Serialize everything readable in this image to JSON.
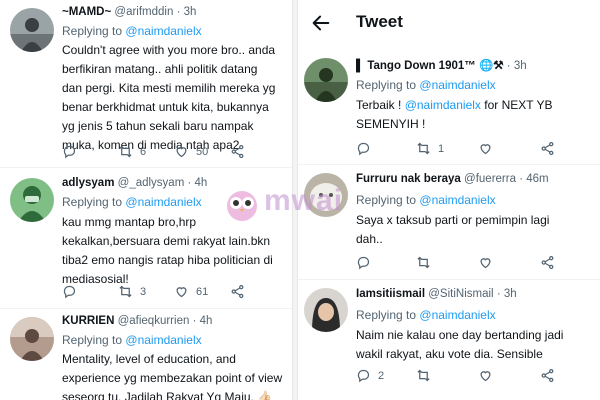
{
  "left_tweets": [
    {
      "name": "~MAMD~",
      "handle": "@arifmddin",
      "time": "3h",
      "replying_prefix": "Replying to",
      "replying_to": "@naimdanielx",
      "lines": [
        "Couldn't agree with you more bro.. anda",
        "berfikiran matang.. ahli politik datang",
        "dan pergi. Kita mesti memilih mereka yg",
        "benar berkhidmat untuk kita, bukannya",
        "yg jenis 5 tahun sekali baru nampak",
        "muka, komen di media ntah apa2"
      ],
      "replies": "",
      "retweets": "6",
      "likes": "50",
      "avatar_colors": [
        "#9aa3a6",
        "#3a3f44"
      ]
    },
    {
      "name": "adlysyam",
      "handle": "@_adlysyam",
      "time": "4h",
      "replying_prefix": "Replying to",
      "replying_to": "@naimdanielx",
      "lines": [
        "kau mmg mantap bro,hrp",
        "kekalkan,bersuara demi rakyat lain.bkn",
        "tiba2 emo nangis ratap hiba politician di",
        "mediasosial!"
      ],
      "replies": "",
      "retweets": "3",
      "likes": "61",
      "avatar_colors": [
        "#7fbf86",
        "#2f6b3a"
      ]
    },
    {
      "name": "KURRIEN",
      "handle": "@afieqkurrien",
      "time": "4h",
      "replying_prefix": "Replying to",
      "replying_to": "@naimdanielx",
      "lines": [
        "Mentality, level of education, and",
        "experience yg membezakan point of view",
        "seseorg tu. Jadilah Rakyat Yg Maju. 👍🏻"
      ],
      "avatar_colors": [
        "#b39b8e",
        "#5e4a40"
      ]
    }
  ],
  "right_header": {
    "title": "Tweet"
  },
  "right_tweets": [
    {
      "name": "▌ Tango Down 1901™ 🌐⚒",
      "handle": "",
      "time": "3h",
      "replying_prefix": "Replying to",
      "replying_to": "@naimdanielx",
      "lines": [
        [
          "Terbaik ! ",
          "@naimdanielx",
          " for NEXT YB"
        ],
        [
          "SEMENYIH !"
        ]
      ],
      "replies": "",
      "retweets": "1",
      "likes": "",
      "avatar_colors": [
        "#6f8f6a",
        "#24361f"
      ]
    },
    {
      "name": "Furruru nak beraya",
      "handle": "@fuererra",
      "time": "46m",
      "replying_prefix": "Replying to",
      "replying_to": "@naimdanielx",
      "lines": [
        [
          "Saya x taksub parti or pemimpin lagi"
        ],
        [
          "dah.."
        ]
      ],
      "replies": "",
      "retweets": "",
      "likes": "",
      "avatar_colors": [
        "#f1efe9",
        "#b9b4a6"
      ]
    },
    {
      "name": "Iamsitiismail",
      "handle": "@SitiNismail",
      "time": "3h",
      "replying_prefix": "Replying to",
      "replying_to": "@naimdanielx",
      "lines": [
        [
          "Naim nie kalau one day bertanding jadi"
        ],
        [
          "wakil rakyat, aku vote dia. Sensible"
        ]
      ],
      "replies": "2",
      "retweets": "",
      "likes": "",
      "avatar_colors": [
        "#d8d4cf",
        "#2b2b2b"
      ]
    }
  ],
  "watermark": {
    "text": "mwai"
  },
  "colors": {
    "link": "#1d9bf0",
    "secondary": "#536471",
    "text": "#0f1419"
  },
  "icons": [
    "reply-icon",
    "retweet-icon",
    "like-icon",
    "share-icon",
    "back-arrow-icon"
  ]
}
